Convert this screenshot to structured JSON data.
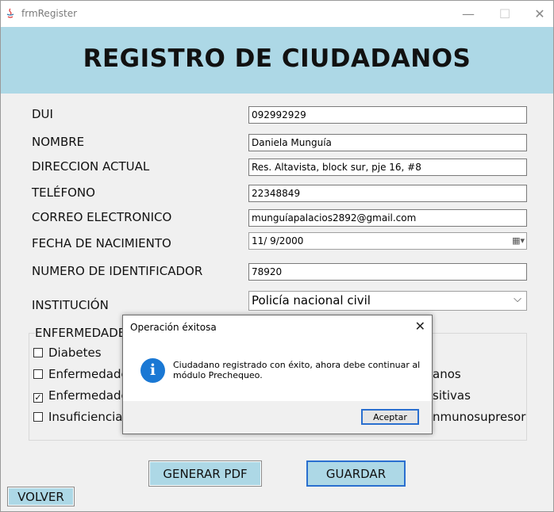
{
  "window": {
    "title": "frmRegister",
    "minimize": "—",
    "maximize": "☐",
    "close": "✕"
  },
  "banner": {
    "heading": "REGISTRO DE CIUDADANOS",
    "color": "#add8e6"
  },
  "form": {
    "dui": {
      "label": "DUI",
      "value": "092992929"
    },
    "nombre": {
      "label": "NOMBRE",
      "value": "Daniela Munguía"
    },
    "direccion": {
      "label": "DIRECCION ACTUAL",
      "value": "Res. Altavista, block sur, pje 16, #8"
    },
    "telefono": {
      "label": "TELÉFONO",
      "value": "22348849"
    },
    "correo": {
      "label": "CORREO ELECTRONICO",
      "value": "munguíapalacios2892@gmail.com"
    },
    "fecha": {
      "label": "FECHA DE NACIMIENTO",
      "value": "11/  9/2000"
    },
    "identificador": {
      "label": "NUMERO DE IDENTIFICADOR",
      "value": "78920"
    },
    "institucion": {
      "label": "INSTITUCIÓN",
      "selected": "Policía nacional civil"
    }
  },
  "enfermedades": {
    "title": "ENFERMEDADE",
    "items": [
      {
        "label": "Diabetes",
        "checked": false
      },
      {
        "label": "Enfermedade",
        "checked": false
      },
      {
        "label": "Enfermedade",
        "checked": true
      },
      {
        "label": "Insuficiencia",
        "checked": false
      }
    ],
    "right_fragments": [
      "anos",
      "sitivas",
      "nmunosupresor"
    ]
  },
  "buttons": {
    "pdf": "GENERAR PDF",
    "guardar": "GUARDAR",
    "volver": "VOLVER"
  },
  "dialog": {
    "title": "Operación éxitosa",
    "close": "✕",
    "icon": "i",
    "message": "Ciudadano registrado con éxito, ahora debe continuar al módulo Prechequeo.",
    "ok": "Aceptar",
    "icon_color": "#1a78d4"
  }
}
